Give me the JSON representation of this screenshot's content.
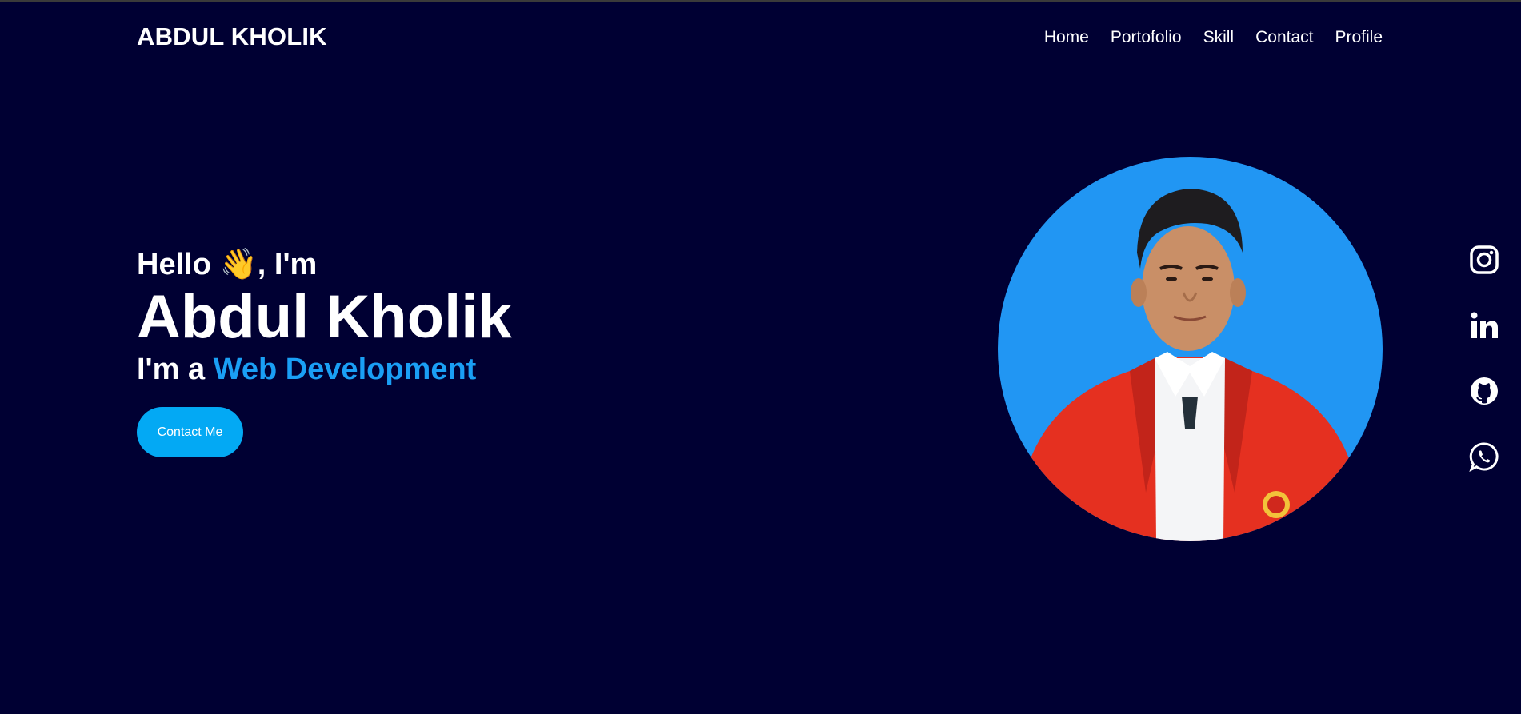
{
  "header": {
    "brand": "ABDUL KHOLIK",
    "nav": [
      "Home",
      "Portofolio",
      "Skill",
      "Contact",
      "Profile"
    ]
  },
  "hero": {
    "hello_prefix": "Hello ",
    "wave_emoji": "👋",
    "hello_suffix": ", I'm",
    "name": "Abdul Kholik",
    "role_prefix": "I'm a ",
    "role_highlight": "Web Development",
    "cta_label": "Contact Me"
  },
  "portrait": {
    "alt": "Abdul Kholik"
  },
  "social": [
    "instagram-icon",
    "linkedin-icon",
    "github-icon",
    "whatsapp-icon"
  ],
  "colors": {
    "background": "#000033",
    "accent": "#1a9ff5",
    "button": "#03a9f4",
    "portrait_bg": "#2196f3",
    "jacket": "#e53020"
  }
}
